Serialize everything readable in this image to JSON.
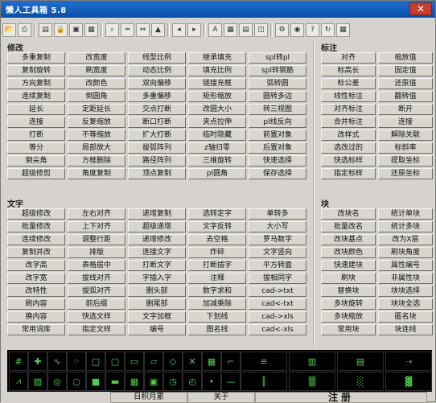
{
  "window": {
    "title": "懒人工具箱 5.8",
    "close_label": "✕"
  },
  "toolbar": {
    "icons": [
      "open-folder-icon",
      "print-icon",
      "clipboard-icon",
      "lock-icon",
      "save-icon",
      "grid-icon",
      "magnifier-icon",
      "ruler-icon",
      "measure-icon",
      "paint-icon",
      "arrow-left-icon",
      "arrow-right-icon",
      "text-icon",
      "table-icon",
      "doc-icon",
      "layers-icon",
      "settings-icon",
      "camera-icon",
      "help-icon",
      "refresh-icon",
      "calculator-icon"
    ]
  },
  "sections": {
    "modify": {
      "title": "修改",
      "buttons": [
        "多重复制",
        "改宽度",
        "线型比例",
        "继承填充",
        "spl转pl",
        "复制旋转",
        "刷宽度",
        "动态比例",
        "填充比例",
        "spl转钢筋",
        "方向复制",
        "改颜色",
        "双向偏移",
        "链接充框",
        "弧转圆",
        "连续复制",
        "倒圆角",
        "多重偏移",
        "矩形缩放",
        "圆转多边",
        "延长",
        "定距延长",
        "交点打断",
        "改圆大小",
        "转三视图",
        "连接",
        "反复缩放",
        "断口打断",
        "夹点拉伸",
        "pl线反向",
        "打断",
        "不等缩放",
        "扩大打断",
        "临时隐藏",
        "前置对象",
        "等分",
        "局部放大",
        "拔弧阵列",
        "z轴归零",
        "后置对象",
        "倒尖角",
        "方框删除",
        "路径阵列",
        "三维旋转",
        "快速选择",
        "超级修剪",
        "角度复制",
        "顶点复制",
        "pl圆角",
        "保存选择"
      ]
    },
    "annotate": {
      "title": "标注",
      "buttons": [
        "对齐",
        "缩放值",
        "标高长",
        "固定值",
        "标公差",
        "还原值",
        "线性标注",
        "翻转值",
        "对齐标注",
        "断开",
        "合并标注",
        "连接",
        "改样式",
        "解除关联",
        "选改过的",
        "标斜率",
        "快选标样",
        "提取坐标",
        "指定标样",
        "还原坐标"
      ]
    },
    "text": {
      "title": "文字",
      "buttons": [
        "超级修改",
        "左右对齐",
        "递增复制",
        "选转定字",
        "单转多",
        "批量修改",
        "上下对齐",
        "超级递增",
        "文字反转",
        "大小写",
        "连续修改",
        "调整行距",
        "递增修改",
        "去空格",
        "罗马数字",
        "复制并改",
        "排版",
        "连接文字",
        "炸碎",
        "文字竖向",
        "改字高",
        "表格居中",
        "打断文字",
        "打断插字",
        "平方转面",
        "改字宽",
        "拔线对齐",
        "字插入字",
        "注释",
        "拔相同字",
        "改特性",
        "拔弧对齐",
        "删头部",
        "数字求和",
        "cad->txt",
        "刷内容",
        "前后缀",
        "删尾部",
        "加减乘除",
        "cad<-txt",
        "换内容",
        "快选文样",
        "文字加框",
        "下划线",
        "cad->xls",
        "常用词库",
        "指定文样",
        "编号",
        "图名线",
        "cad<-xls"
      ]
    },
    "block": {
      "title": "块",
      "buttons": [
        "改块名",
        "统计单块",
        "批量改名",
        "统计多块",
        "改块基点",
        "改为X层",
        "改块颜色",
        "刷块角度",
        "快速建块",
        "属性编号",
        "刷块",
        "非属性块",
        "替换块",
        "块块选择",
        "多块旋转",
        "块块全选",
        "多块缩放",
        "匿名块",
        "常用块",
        "块连线"
      ]
    }
  },
  "strip": {
    "icons": [
      "grid-shape-icon",
      "plus-cross-icon",
      "wave-icon",
      "dots-icon",
      "square-icon",
      "frame-icon",
      "border-icon",
      "chat-icon",
      "diamond-icon",
      "x-mark-icon",
      "window-icon",
      "stair-icon",
      "wide-line-icon",
      "bars-icon",
      "bars2-icon",
      "arrow-icon",
      "zigzag-icon",
      "hatch-icon",
      "target-icon",
      "circle-icon",
      "box-icon",
      "bar-icon",
      "grid2-icon",
      "square2-icon",
      "clock-icon",
      "timer-icon",
      "dot-icon",
      "dash-icon",
      "pipe-icon",
      "pattern-icon",
      "pattern2-icon",
      "pattern3-icon"
    ]
  },
  "status": {
    "date": "日积月累",
    "about": "关于",
    "register": "注册"
  }
}
